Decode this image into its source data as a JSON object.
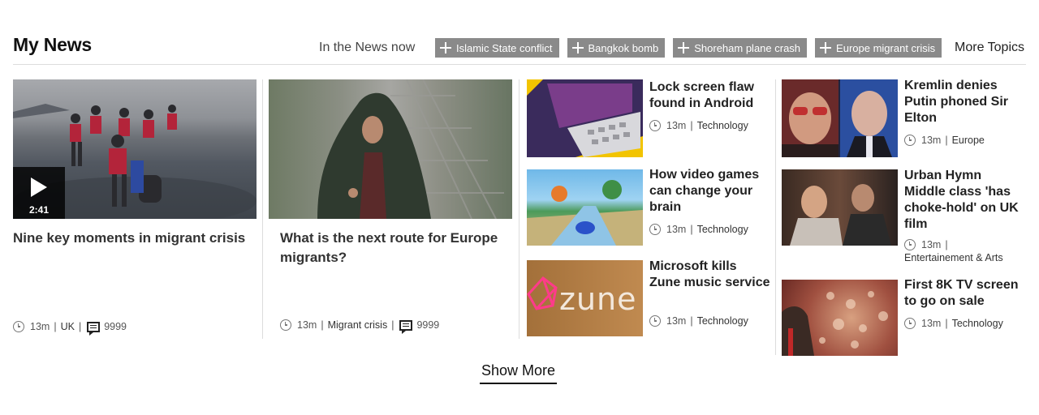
{
  "header": {
    "title": "My News",
    "in_the_news_label": "In the News now",
    "topics": [
      {
        "label": "Islamic State conflict"
      },
      {
        "label": "Bangkok bomb"
      },
      {
        "label": "Shoreham plane crash"
      },
      {
        "label": "Europe migrant crisis"
      }
    ],
    "more_topics_label": "More Topics"
  },
  "featured": [
    {
      "title": "Nine key moments in migrant crisis",
      "time": "13m",
      "section": "UK",
      "comments": "9999",
      "video_duration": "2:41"
    },
    {
      "title": "What is the next route for Europe migrants?",
      "time": "13m",
      "section": "Migrant crisis",
      "comments": "9999"
    }
  ],
  "stories_col3": [
    {
      "title": "Lock screen flaw found in Android",
      "time": "13m",
      "section": "Technology"
    },
    {
      "title": "How video games can change your brain",
      "time": "13m",
      "section": "Technology"
    },
    {
      "title": "Microsoft kills Zune music service",
      "time": "13m",
      "section": "Technology",
      "image_text": "zune"
    }
  ],
  "stories_col4": [
    {
      "title": "Kremlin denies Putin phoned Sir Elton",
      "time": "13m",
      "section": "Europe"
    },
    {
      "title": "Urban Hymn Middle class 'has choke-hold' on UK film",
      "time": "13m",
      "section": "Entertainement & Arts"
    },
    {
      "title": "First 8K TV screen to go on sale",
      "time": "13m",
      "section": "Technology"
    }
  ],
  "show_more_label": "Show More",
  "colors": {
    "topic_bg": "#8a8a8a",
    "divider": "#dcdcdc",
    "title_text": "#333333"
  }
}
